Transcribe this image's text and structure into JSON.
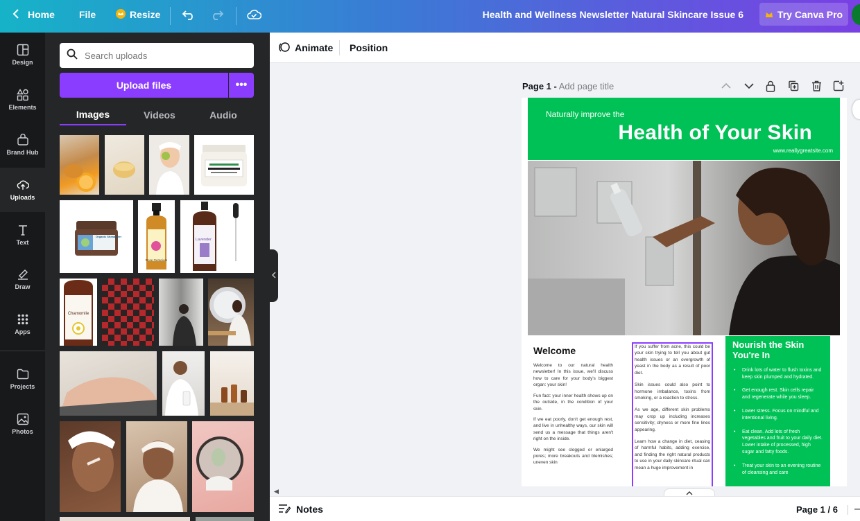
{
  "topbar": {
    "home_label": "Home",
    "file_label": "File",
    "resize_label": "Resize",
    "doc_title": "Health and Wellness Newsletter Natural Skincare Issue 6",
    "pro_label": "Try Canva Pro",
    "accent": "#8b3dff"
  },
  "rail": {
    "items": [
      {
        "label": "Design",
        "icon": "layout-icon"
      },
      {
        "label": "Elements",
        "icon": "shapes-icon"
      },
      {
        "label": "Brand Hub",
        "icon": "brand-icon"
      },
      {
        "label": "Uploads",
        "icon": "cloud-upload-icon"
      },
      {
        "label": "Text",
        "icon": "text-icon"
      },
      {
        "label": "Draw",
        "icon": "pen-icon"
      },
      {
        "label": "Apps",
        "icon": "grid-icon"
      },
      {
        "label": "Projects",
        "icon": "folder-icon"
      },
      {
        "label": "Photos",
        "icon": "image-icon"
      }
    ]
  },
  "uploads": {
    "search_placeholder": "Search uploads",
    "upload_label": "Upload files",
    "more_label": "•••",
    "tabs": [
      "Images",
      "Videos",
      "Audio"
    ]
  },
  "toolbar": {
    "animate_label": "Animate",
    "position_label": "Position"
  },
  "page": {
    "label": "Page 1 -",
    "title_placeholder": "Add page title"
  },
  "newsletter": {
    "kicker": "Naturally improve the",
    "headline": "Health of Your Skin",
    "url": "www.reallygreatsite.com",
    "welcome_heading": "Welcome",
    "welcome_paragraphs": [
      "Welcome to our natural health newsletter! In this issue, we'll discuss how to care for your body's biggest organ: your skin!",
      "Fun fact: your inner health shows up on the outside, in the condition of your skin.",
      "If we eat poorly, don't get enough rest, and live in unhealthy ways, our skin will send us a message that things aren't right on the inside.",
      "We might see clogged or enlarged pores; more breakouts and blemishes; uneven skin"
    ],
    "middle_paragraphs": [
      "If you suffer from acne, this could be your skin trying to tell you about gut health issues or an overgrowth of yeast in the body as a result of poor diet.",
      "Skin issues could also point to hormone imbalance, toxins from smoking, or a reaction to stress.",
      "As we age, different skin problems may crop up including increases sensitivity; dryness or more fine lines appearing.",
      "Learn how a change in diet, ceasing of harmful habits, adding exercise, and finding the right natural products to use in your daily skincare ritual can mean a huge improvement in"
    ],
    "nourish_heading": "Nourish the Skin You're In",
    "nourish_items": [
      "Drink lots of water to flush toxins and keep skin plumped and hydrated.",
      "Get enough rest. Skin cells repair and regenerate while you sleep.",
      "Lower stress. Focus on mindful and intentional living.",
      "Eat clean. Add lots of fresh vegetables and fruit to your daily diet. Lower intake of processed, high sugar and fatty foods.",
      "Treat your skin to an evening routine of cleansing and care"
    ],
    "green": "#00c155"
  },
  "bottombar": {
    "notes_label": "Notes",
    "page_counter": "Page 1 / 6"
  },
  "thumbnails": {
    "row2": {
      "product_a": "Organic Sheabutter",
      "product_b": "Rose Geranium",
      "product_c": "Lavender"
    },
    "row3": {
      "product_d": "Chamomile"
    }
  }
}
